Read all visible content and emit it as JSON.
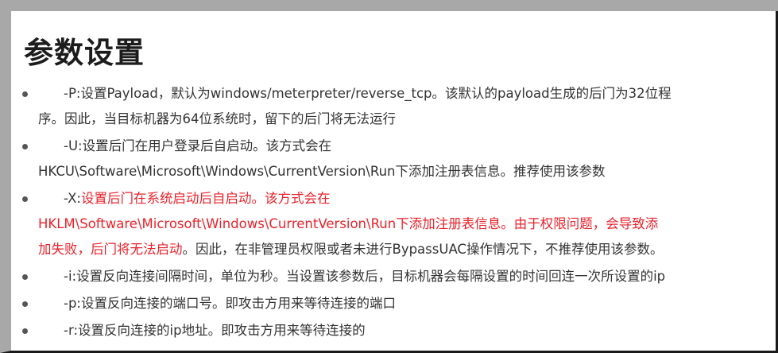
{
  "title": "参数设置",
  "items": [
    {
      "p1": "-P:设置Payload，默认为windows/meterpreter/reverse_tcp。该默认的payload生成的后门为32位程",
      "p2": "序。因此，当目标机器为64位系统时，留下的后门将无法运行"
    },
    {
      "p1": "-U:设置后门在用户登录后自启动。该方式会在",
      "p2": "HKCU\\Software\\Microsoft\\Windows\\CurrentVersion\\Run下添加注册表信息。推荐使用该参数"
    },
    {
      "prefix": "-X:",
      "red1": "设置后门在系统启动后自启动。该方式会在",
      "red2": "HKLM\\Software\\Microsoft\\Windows\\CurrentVersion\\Run下添加注册表信息。由于权限问题，会导致添",
      "red3": "加失败，后门将无法启动",
      "tail": "。因此，在非管理员权限或者未进行BypassUAC操作情况下，不推荐使用该参数。"
    },
    {
      "p1": "-i:设置反向连接间隔时间，单位为秒。当设置该参数后，目标机器会每隔设置的时间回连一次所设置的ip"
    },
    {
      "p1": "-p:设置反向连接的端口号。即攻击方用来等待连接的端口"
    },
    {
      "p1": "-r:设置反向连接的ip地址。即攻击方用来等待连接的"
    }
  ],
  "colors": {
    "text": "#333333",
    "highlight": "#e8222b",
    "frame": "#a8a8a8"
  }
}
